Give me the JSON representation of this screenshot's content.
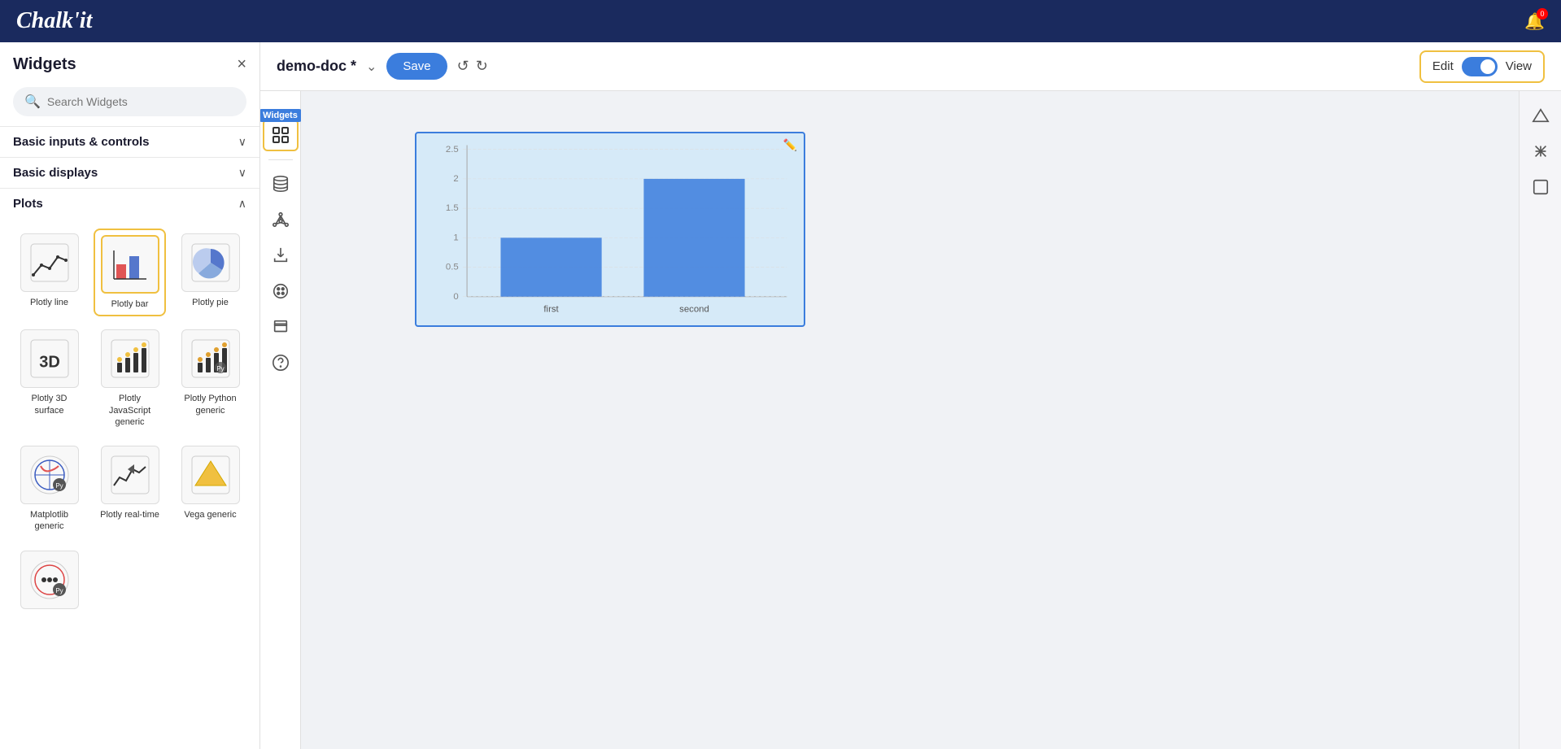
{
  "app": {
    "logo": "Chalk'it",
    "bell_badge": "0"
  },
  "sidebar": {
    "title": "Widgets",
    "close_label": "×",
    "search_placeholder": "Search Widgets",
    "sections": [
      {
        "id": "basic-inputs",
        "label": "Basic inputs & controls",
        "expanded": false,
        "chevron": "∨"
      },
      {
        "id": "basic-displays",
        "label": "Basic displays",
        "expanded": false,
        "chevron": "∨"
      },
      {
        "id": "plots",
        "label": "Plots",
        "expanded": true,
        "chevron": "∧"
      }
    ],
    "widgets": [
      {
        "id": "plotly-line",
        "label": "Plotly line",
        "selected": false,
        "icon_type": "line"
      },
      {
        "id": "plotly-bar",
        "label": "Plotly bar",
        "selected": true,
        "icon_type": "bar"
      },
      {
        "id": "plotly-pie",
        "label": "Plotly pie",
        "selected": false,
        "icon_type": "pie"
      },
      {
        "id": "plotly-3d",
        "label": "Plotly 3D surface",
        "selected": false,
        "icon_type": "3d"
      },
      {
        "id": "plotly-js",
        "label": "Plotly JavaScript generic",
        "selected": false,
        "icon_type": "jsgeneric"
      },
      {
        "id": "plotly-py",
        "label": "Plotly Python generic",
        "selected": false,
        "icon_type": "pygeneric"
      },
      {
        "id": "matplotlib",
        "label": "Matplotlib generic",
        "selected": false,
        "icon_type": "matplotlib"
      },
      {
        "id": "plotly-realtime",
        "label": "Plotly real-time",
        "selected": false,
        "icon_type": "realtime"
      },
      {
        "id": "vega",
        "label": "Vega generic",
        "selected": false,
        "icon_type": "vega"
      }
    ],
    "more_widget": {
      "id": "more",
      "label": "",
      "icon_type": "more"
    }
  },
  "toolbar": {
    "doc_name": "demo-doc *",
    "doc_chevron": "⌄",
    "save_label": "Save",
    "undo_label": "↺",
    "redo_label": "↻",
    "edit_label": "Edit",
    "view_label": "View"
  },
  "left_bar": {
    "panels": [
      {
        "id": "widgets",
        "label": "Widgets",
        "active": true
      },
      {
        "id": "database",
        "label": "Database"
      },
      {
        "id": "network",
        "label": "Network"
      },
      {
        "id": "import",
        "label": "Import"
      },
      {
        "id": "palette",
        "label": "Palette"
      },
      {
        "id": "layer",
        "label": "Layer"
      },
      {
        "id": "help",
        "label": "Help"
      }
    ]
  },
  "chart": {
    "bars": [
      {
        "label": "first",
        "value": 1.0,
        "color": "#3b7ddd"
      },
      {
        "label": "second",
        "value": 2.0,
        "color": "#3b7ddd"
      }
    ],
    "y_ticks": [
      "0",
      "0.5",
      "1",
      "1.5",
      "2",
      "2.5"
    ]
  },
  "right_panel": {
    "icons": [
      {
        "id": "triangle",
        "label": "Triangle tool"
      },
      {
        "id": "cross",
        "label": "Cross tool"
      },
      {
        "id": "square",
        "label": "Square tool"
      }
    ]
  }
}
